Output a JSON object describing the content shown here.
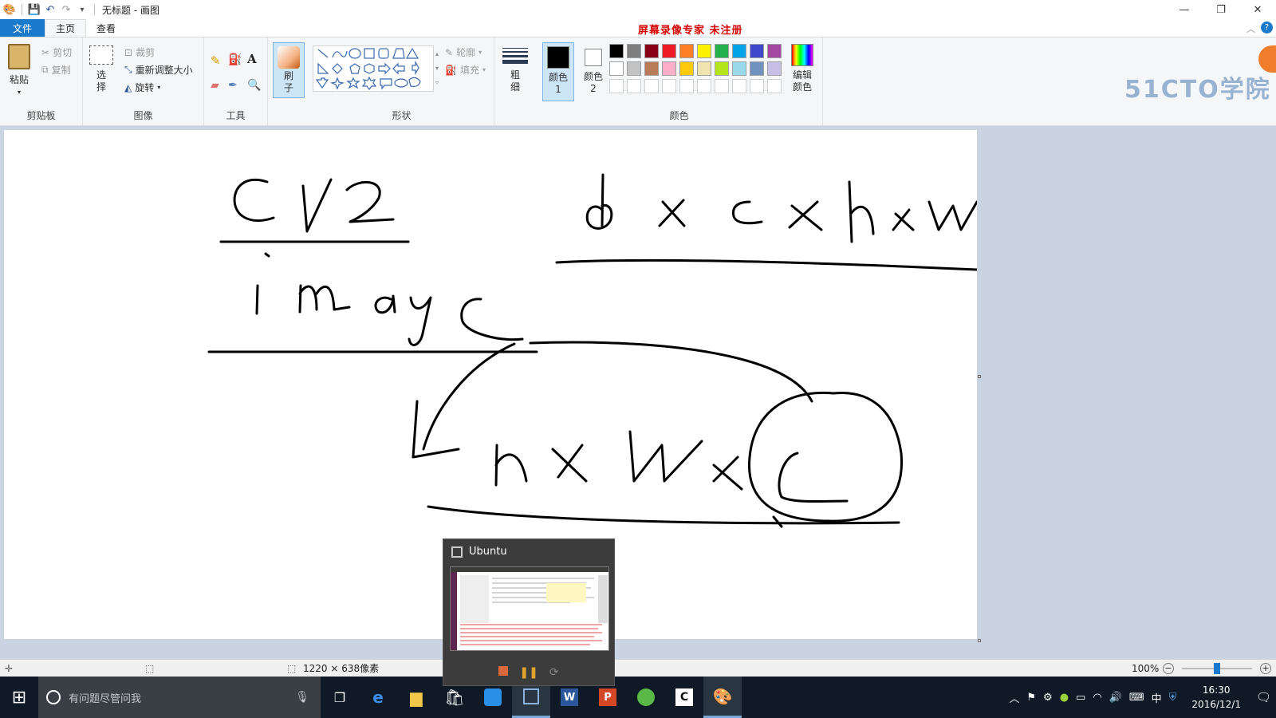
{
  "window": {
    "title": "无标题 - 画图"
  },
  "quick_access": {
    "icons": [
      "paint-app-icon",
      "save-icon",
      "undo-icon",
      "redo-icon",
      "customize-icon"
    ]
  },
  "window_controls": {
    "minimize": "—",
    "restore": "❐",
    "close": "✕"
  },
  "recorder_watermark": "屏幕录像专家  未注册",
  "tabs": [
    {
      "label": "文件"
    },
    {
      "label": "主页"
    },
    {
      "label": "查看"
    }
  ],
  "ribbon": {
    "clipboard": {
      "label": "剪贴板",
      "paste": "粘贴",
      "cut": "剪切",
      "copy": "复制"
    },
    "image": {
      "label": "图像",
      "select": "选择",
      "crop": "裁剪",
      "resize": "重新调整大小",
      "rotate": "旋转"
    },
    "tools": {
      "label": "工具"
    },
    "brushes": {
      "label": "刷子"
    },
    "shapes": {
      "label": "形状",
      "outline": "轮廓",
      "fill": "填充"
    },
    "size": {
      "label": "粗细"
    },
    "colors": {
      "label": "颜色",
      "color1": "颜色 1",
      "color2": "颜色 2",
      "edit": "编辑颜色",
      "palette_row1": [
        "#000000",
        "#7f7f7f",
        "#880015",
        "#ed1c24",
        "#ff7f27",
        "#fff200",
        "#22b14c",
        "#00a2e8",
        "#3f48cc",
        "#a349a4"
      ],
      "palette_row2": [
        "#ffffff",
        "#c3c3c3",
        "#b97a57",
        "#ffaec9",
        "#ffc90e",
        "#efe4b0",
        "#b5e61d",
        "#99d9ea",
        "#7092be",
        "#c8bfe7"
      ]
    }
  },
  "brand_logo": "51CTO学院",
  "statusbar": {
    "canvas_size": "1220 × 638像素",
    "zoom": "100%"
  },
  "taskbar": {
    "search_placeholder": "有问题尽管问我",
    "time": "16:30",
    "date": "2016/12/1",
    "ime": "中"
  },
  "popup": {
    "title": "Ubuntu"
  }
}
